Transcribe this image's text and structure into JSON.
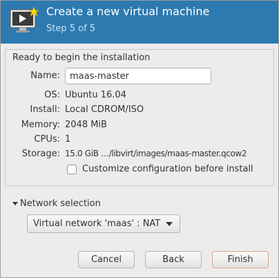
{
  "header": {
    "title": "Create a new virtual machine",
    "step": "Step 5 of 5",
    "icon": "monitor-play-icon"
  },
  "summary": {
    "heading": "Ready to begin the installation",
    "name_label": "Name:",
    "name_value": "maas-master",
    "os_label": "OS:",
    "os_value": "Ubuntu 16.04",
    "install_label": "Install:",
    "install_value": "Local CDROM/ISO",
    "memory_label": "Memory:",
    "memory_value": "2048 MiB",
    "cpus_label": "CPUs:",
    "cpus_value": "1",
    "storage_label": "Storage:",
    "storage_value": "15.0 GiB …/libvirt/images/maas-master.qcow2",
    "customize_label": "Customize configuration before install",
    "customize_checked": false
  },
  "network": {
    "expander_label": "Network selection",
    "selected": "Virtual network 'maas' : NAT"
  },
  "buttons": {
    "cancel": "Cancel",
    "back": "Back",
    "finish": "Finish"
  },
  "colors": {
    "header_bg": "#2c7ab0",
    "finish_border": "#e0a38b"
  }
}
